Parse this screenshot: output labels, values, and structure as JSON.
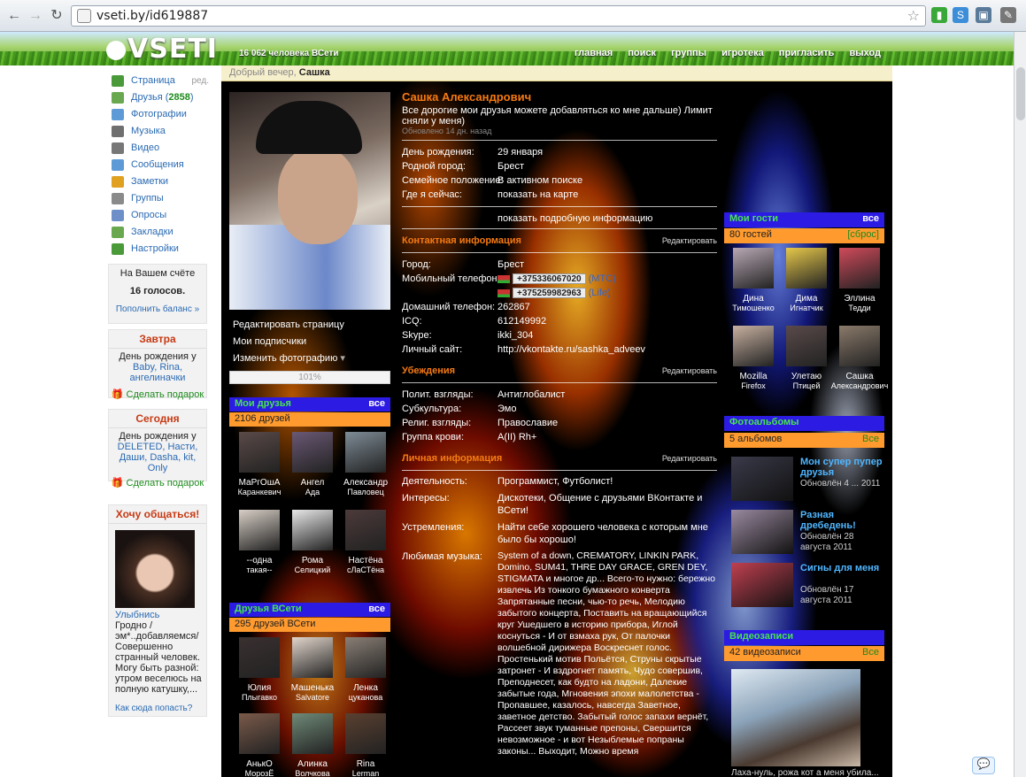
{
  "browser": {
    "url": "vseti.by/id619887"
  },
  "site": {
    "logo": "VSETI",
    "users_online": "16 062 человека ВСети",
    "nav": [
      "главная",
      "поиск",
      "группы",
      "игротека",
      "пригласить",
      "выход"
    ]
  },
  "greeting": {
    "prefix": "Добрый вечер,",
    "name": "Сашка"
  },
  "left_nav": {
    "edit_label": "ред.",
    "items": [
      {
        "label": "Страница",
        "icon": "home-icon",
        "color": "#4a9a3a"
      },
      {
        "label": "Друзья",
        "count": "2858",
        "icon": "friends-icon",
        "color": "#6aa84f"
      },
      {
        "label": "Фотографии",
        "icon": "photos-icon",
        "color": "#5e9bd6"
      },
      {
        "label": "Музыка",
        "icon": "music-icon",
        "color": "#6f6f6f"
      },
      {
        "label": "Видео",
        "icon": "video-icon",
        "color": "#777"
      },
      {
        "label": "Сообщения",
        "icon": "messages-icon",
        "color": "#5e9bd6"
      },
      {
        "label": "Заметки",
        "icon": "notes-icon",
        "color": "#e0a020"
      },
      {
        "label": "Группы",
        "icon": "groups-icon",
        "color": "#8a8a8a"
      },
      {
        "label": "Опросы",
        "icon": "polls-icon",
        "color": "#6f8fc9"
      },
      {
        "label": "Закладки",
        "icon": "bookmarks-icon",
        "color": "#6aa84f"
      },
      {
        "label": "Настройки",
        "icon": "settings-icon",
        "color": "#4a9a3a"
      }
    ]
  },
  "account": {
    "label": "На Вашем счёте",
    "value": "16 голосов.",
    "link": "Пополнить баланс »"
  },
  "tomorrow": {
    "title": "Завтра",
    "line": "День рождения у",
    "names": "Baby, Rina, ангелиначки",
    "gift": "Сделать подарок"
  },
  "today": {
    "title": "Сегодня",
    "line": "День рождения у",
    "names": "DELETED, Насти, Даши, Dasha, kit, Only",
    "gift": "Сделать подарок"
  },
  "want_chat": {
    "title": "Хочу общаться!",
    "name": "Улыбнись",
    "text": "Гродно /эм*..добавляемся/ Совершенно странный человек. Могу быть разной: утром веселюсь на полную катушку,...",
    "link": "Как сюда попасть?"
  },
  "profile": {
    "name": "Сашка Александрович",
    "status": "Все дорогие мои друзья можете добавляться ко мне дальше) Лимит сняли у меня)",
    "updated": "Обновлено 14 дн. назад",
    "actions": [
      "Редактировать страницу",
      "Мои подписчики",
      "Изменить фотографию"
    ],
    "progress": "101%",
    "basic": [
      {
        "k": "День рождения:",
        "v": "29 января"
      },
      {
        "k": "Родной город:",
        "v": "Брест"
      },
      {
        "k": "Семейное положение:",
        "v": "В активном поиске"
      },
      {
        "k": "Где я сейчас:",
        "v": "показать на карте"
      }
    ],
    "more_info": "показать подробную информацию",
    "contact_title": "Контактная информация",
    "edit": "Редактировать",
    "contacts": {
      "city_k": "Город:",
      "city_v": "Брест",
      "mobile_k": "Мобильный телефон:",
      "phone1": "+375336067020",
      "op1": "(МТС)",
      "phone2": "+375259982963",
      "op2": "(Life)",
      "home_k": "Домашний телефон:",
      "home_v": "262867",
      "icq_k": "ICQ:",
      "icq_v": "612149992",
      "skype_k": "Skype:",
      "skype_v": "ikki_304",
      "site_k": "Личный сайт:",
      "site_v": "http://vkontakte.ru/sashka_adveev"
    },
    "beliefs_title": "Убеждения",
    "beliefs": [
      {
        "k": "Полит. взгляды:",
        "v": "Антиглобалист"
      },
      {
        "k": "Субкультура:",
        "v": "Эмо"
      },
      {
        "k": "Религ. взгляды:",
        "v": "Православие"
      },
      {
        "k": "Группа крови:",
        "v": "A(II) Rh+"
      }
    ],
    "personal_title": "Личная информация",
    "personal": [
      {
        "k": "Деятельность:",
        "v": "Программист, Футболист!"
      },
      {
        "k": "Интересы:",
        "v": "Дискотеки, Общение с друзьями ВКонтакте и ВСети!"
      },
      {
        "k": "Устремления:",
        "v": "Найти себе хорошего человека с которым мне было бы хорошо!"
      },
      {
        "k": "Любимая музыка:",
        "v": "System of a down, CREMATORY, LINKIN PARK, Domino, SUM41, THRE DAY GRACE, GREN DEY, STIGMATA и многое др... Всего-то нужно: бережно извлечь Из тонкого бумажного конверта Запрятанные песни, чью-то речь, Мелодию забытого концерта, Поставить на вращающийся круг Ушедшего в историю прибора, Иглой коснуться - И от взмаха рук, От палочки волшебной дирижера Воскреснет голос. Простенький мотив Польётся, Струны скрытые затронет - И вздрогнет память, Чудо совершив, Преподнесет, как будто на ладони, Далекие забытые года, Мгновения эпохи малолетства - Пропавшее, казалось, навсегда Заветное, заветное детство. Забытый голос запахи вернёт, Рассеет звук туманные препоны, Свершится невозможное - и вот Незыблемые попраны законы... Выходит, Можно время"
      }
    ]
  },
  "my_friends": {
    "title": "Мои друзья",
    "all": "все",
    "count": "2106 друзей",
    "items": [
      {
        "n1": "МаРгОшА",
        "n2": "Каранкевич",
        "c": "#5a4a48"
      },
      {
        "n1": "Ангел",
        "n2": "Ада",
        "c": "#6a5874"
      },
      {
        "n1": "Александр",
        "n2": "Павловец",
        "c": "#7e8c96"
      },
      {
        "n1": "--одна",
        "n2": "такая--",
        "c": "#d8cfc6"
      },
      {
        "n1": "Рома",
        "n2": "Селицкий",
        "c": "#e8e8e8"
      },
      {
        "n1": "Настёна",
        "n2": "сЛаСТёна",
        "c": "#4c3a3a"
      }
    ]
  },
  "vseti_friends": {
    "title": "Друзья ВСети",
    "all": "все",
    "count": "295 друзей ВСети",
    "items": [
      {
        "n1": "Юлия",
        "n2": "Плыгавко",
        "c": "#3a3030"
      },
      {
        "n1": "Машенька",
        "n2": "Salvatore",
        "c": "#e2d6cc"
      },
      {
        "n1": "Ленка",
        "n2": "цуканова",
        "c": "#8a7f76"
      },
      {
        "n1": "АнькО",
        "n2": "МорозЁ",
        "c": "#7a5a4a"
      },
      {
        "n1": "Алинка",
        "n2": "Волчкова",
        "c": "#6f8a78"
      },
      {
        "n1": "Rina",
        "n2": "Lerman",
        "c": "#5a4030"
      }
    ]
  },
  "guests": {
    "title": "Мои гости",
    "all": "все",
    "count": "80 гостей",
    "reset": "[сброс]",
    "items": [
      {
        "n1": "Дина",
        "n2": "Тимошенко",
        "c": "#b8a8b4"
      },
      {
        "n1": "Дима",
        "n2": "Игнатчик",
        "c": "#e6c84a"
      },
      {
        "n1": "Эллина",
        "n2": "Тедди",
        "c": "#d04a5a"
      },
      {
        "n1": "Mozilla",
        "n2": "Firefox",
        "c": "#c7b0a0"
      },
      {
        "n1": "Улетаю",
        "n2": "Птицей",
        "c": "#5a4a4a"
      },
      {
        "n1": "Сашка",
        "n2": "Александрович",
        "c": "#8a7a6a"
      }
    ]
  },
  "albums": {
    "title": "Фотоальбомы",
    "count": "5 альбомов",
    "all": "Все",
    "items": [
      {
        "t": "Мон супер пупер друзья",
        "d": "Обновлён 4 ... 2011",
        "c": "#3a3a4a"
      },
      {
        "t": "Разная дребедень!",
        "d": "Обновлён 28 августа 2011",
        "c": "#9a8aa0"
      },
      {
        "t": "Сигны для меня",
        "d": "Обновлён 17 августа 2011",
        "c": "#c04050"
      }
    ]
  },
  "videos": {
    "title": "Видеозаписи",
    "count": "42 видеозаписи",
    "all": "Все",
    "caption": "Лаха-нуль, рожа кот а меня убила..."
  }
}
